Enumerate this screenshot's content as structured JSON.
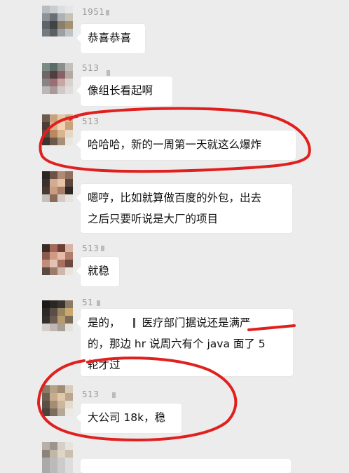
{
  "chat": {
    "messages": [
      {
        "sender": "1951",
        "text": "恭喜恭喜"
      },
      {
        "sender": "513",
        "text": "像组长看起啊"
      },
      {
        "sender": "513",
        "text": "哈哈哈，新的一周第一天就这么爆炸"
      },
      {
        "sender": "",
        "line1": "嗯哼，比如就算做百度的外包，出去",
        "line2": "之后只要听说是大厂的项目"
      },
      {
        "sender": "513",
        "text": "就稳"
      },
      {
        "sender": "51",
        "line1_a": "是的，",
        "line1_b": "医疗部门据说还是满严",
        "line2": "的，那边 hr 说周六有个 java 面了 5",
        "line3": "轮才过"
      },
      {
        "sender": "513",
        "text": "大公司 18k，稳"
      }
    ]
  },
  "colors": {
    "background": "#ececec",
    "bubble": "#ffffff",
    "annotation": "#e0201f"
  }
}
